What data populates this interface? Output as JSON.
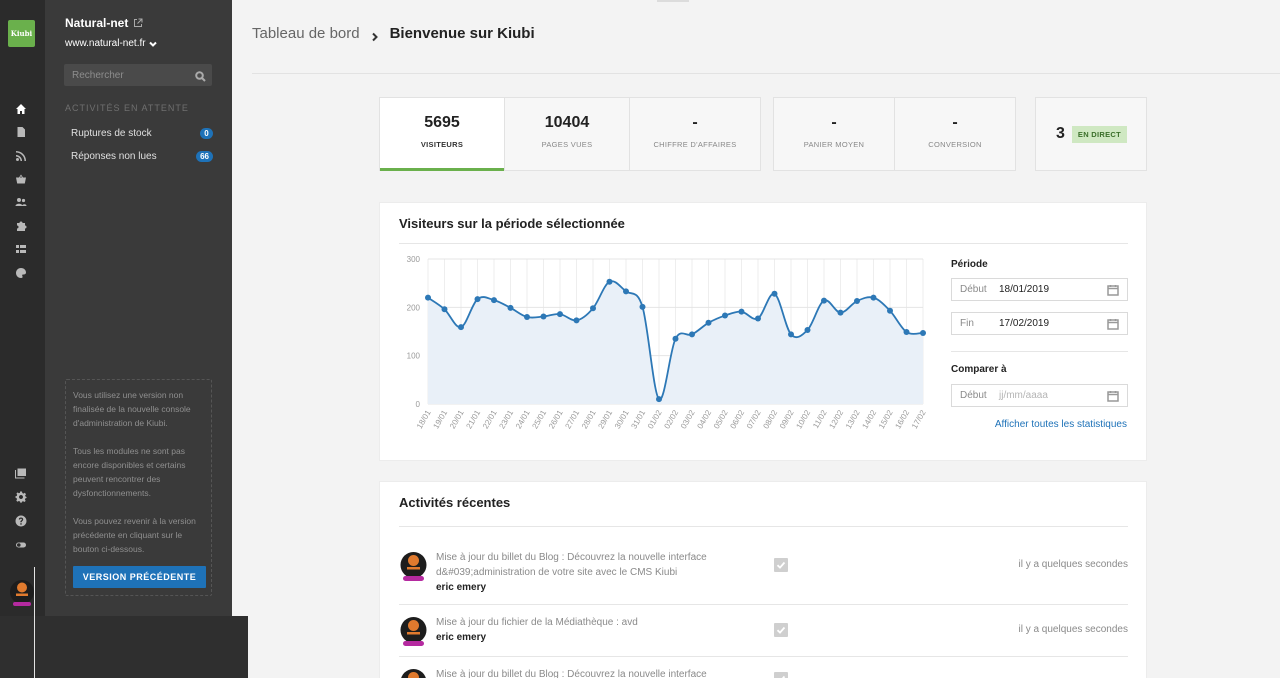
{
  "app": {
    "logo_text": "Kiubi"
  },
  "rail": {
    "icons": [
      "home-icon",
      "document-icon",
      "rss-icon",
      "basket-icon",
      "users-icon",
      "puzzle-icon",
      "list-icon",
      "palette-icon",
      "media-icon",
      "settings-icon",
      "help-icon",
      "toggle-icon"
    ]
  },
  "sidebar": {
    "site_name": "Natural-net",
    "site_url": "www.natural-net.fr",
    "search_placeholder": "Rechercher",
    "section_title": "ACTIVITÉS EN ATTENTE",
    "pending": [
      {
        "label": "Ruptures de stock",
        "count": "0"
      },
      {
        "label": "Réponses non lues",
        "count": "66"
      }
    ],
    "notice": {
      "p1": "Vous utilisez une version non finalisée de la nouvelle console d'administration de Kiubi.",
      "p2": "Tous les modules ne sont pas encore disponibles et certains peuvent rencontrer des dysfonctionnements.",
      "p3": "Vous pouvez revenir à la version précédente en cliquant sur le bouton ci-dessous.",
      "button": "VERSION PRÉCÉDENTE"
    }
  },
  "breadcrumb": {
    "parent": "Tableau de bord",
    "current": "Bienvenue sur Kiubi"
  },
  "kpis": [
    {
      "value": "5695",
      "label": "VISITEURS",
      "active": true
    },
    {
      "value": "10404",
      "label": "PAGES VUES"
    },
    {
      "value": "-",
      "label": "CHIFFRE D'AFFAIRES"
    },
    {
      "value": "-",
      "label": "PANIER MOYEN"
    },
    {
      "value": "-",
      "label": "CONVERSION"
    }
  ],
  "live": {
    "count": "3",
    "label": "EN DIRECT"
  },
  "visitors_card": {
    "title": "Visiteurs sur la période sélectionnée",
    "period_label": "Période",
    "start_key": "Début",
    "start_value": "18/01/2019",
    "end_key": "Fin",
    "end_value": "17/02/2019",
    "compare_label": "Comparer à",
    "compare_key": "Début",
    "compare_placeholder": "jj/mm/aaaa",
    "link": "Afficher toutes les statistiques"
  },
  "chart_data": {
    "type": "area",
    "x": [
      "18/01",
      "19/01",
      "20/01",
      "21/01",
      "22/01",
      "23/01",
      "24/01",
      "25/01",
      "26/01",
      "27/01",
      "28/01",
      "29/01",
      "30/01",
      "31/01",
      "01/02",
      "02/02",
      "03/02",
      "04/02",
      "05/02",
      "06/02",
      "07/02",
      "08/02",
      "09/02",
      "10/02",
      "11/02",
      "12/02",
      "13/02",
      "14/02",
      "15/02",
      "16/02",
      "17/02"
    ],
    "values": [
      220,
      196,
      159,
      217,
      215,
      199,
      180,
      181,
      186,
      173,
      198,
      253,
      233,
      201,
      10,
      135,
      144,
      168,
      183,
      191,
      177,
      228,
      144,
      153,
      214,
      189,
      213,
      220,
      193,
      149,
      147
    ],
    "ylim": [
      0,
      300
    ],
    "yticks": [
      0,
      100,
      200,
      300
    ],
    "grid": true,
    "color": "#2d78b6",
    "fill": "#e9f0f8"
  },
  "activity_card": {
    "title": "Activités récentes",
    "items": [
      {
        "text": "Mise à jour du billet du Blog : Découvrez la nouvelle interface d&#039;administration de votre site avec le CMS Kiubi",
        "author": "eric emery",
        "time": "il y a quelques secondes"
      },
      {
        "text": "Mise à jour du fichier de la Médiathèque : avd",
        "author": "eric emery",
        "time": "il y a quelques secondes"
      },
      {
        "text": "Mise à jour du billet du Blog : Découvrez la nouvelle interface",
        "author": "",
        "time": ""
      }
    ]
  }
}
